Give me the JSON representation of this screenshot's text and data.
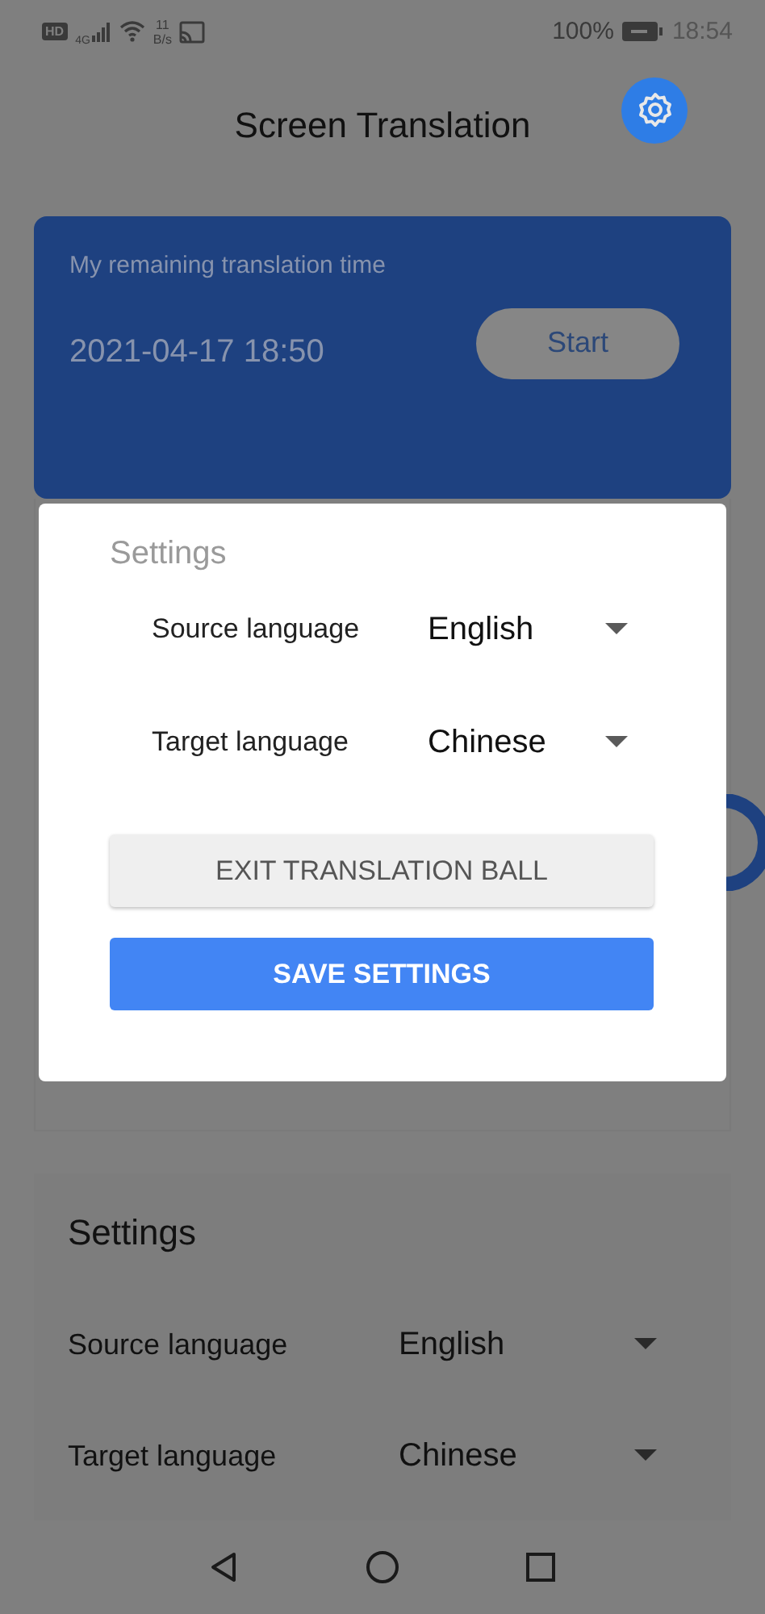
{
  "status_bar": {
    "hd": "HD",
    "network": "4G",
    "speed_value": "11",
    "speed_unit": "B/s",
    "battery": "100%",
    "time": "18:54"
  },
  "header": {
    "title": "Screen Translation"
  },
  "timer_card": {
    "label": "My remaining translation time",
    "time": "2021-04-17 18:50",
    "start_button": "Start"
  },
  "settings_card": {
    "title": "Settings",
    "rows": [
      {
        "label": "Source language",
        "value": "English"
      },
      {
        "label": "Target language",
        "value": "Chinese"
      }
    ]
  },
  "dialog": {
    "title": "Settings",
    "rows": [
      {
        "label": "Source language",
        "value": "English"
      },
      {
        "label": "Target language",
        "value": "Chinese"
      }
    ],
    "buttons": [
      {
        "label": "EXIT TRANSLATION BALL",
        "kind": "secondary"
      },
      {
        "label": "SAVE SETTINGS",
        "kind": "primary"
      }
    ]
  }
}
